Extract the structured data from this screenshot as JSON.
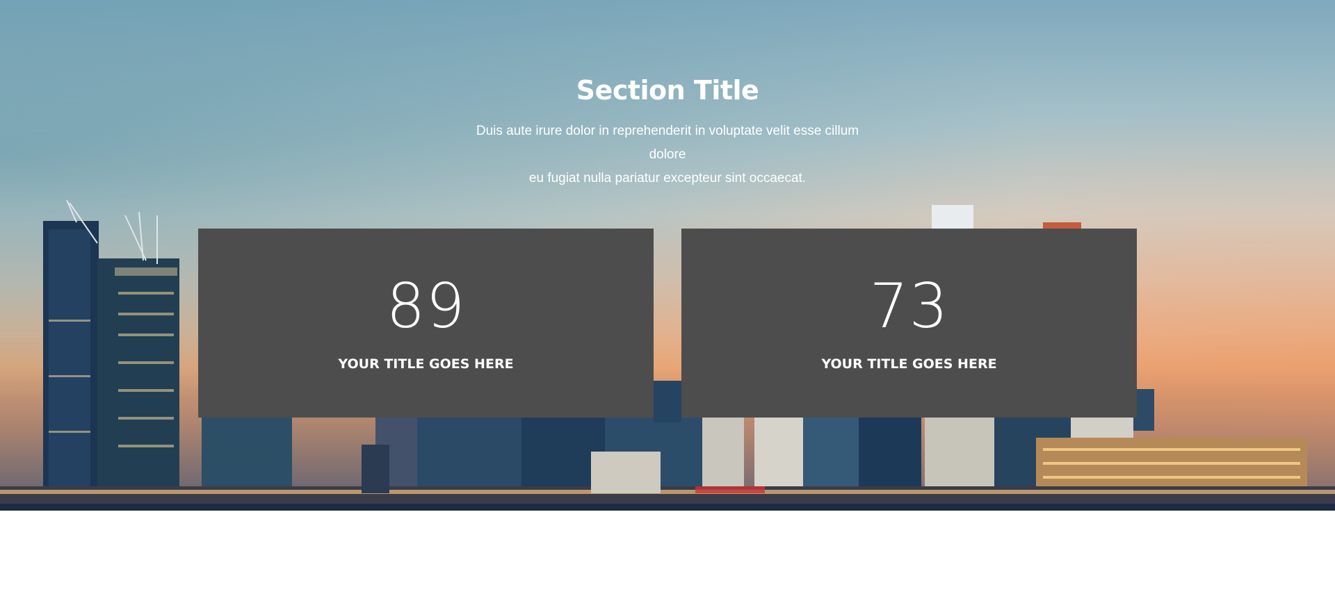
{
  "section": {
    "title": "Section Title",
    "subtitle_line1": "Duis aute irure dolor in reprehenderit in voluptate velit esse cillum dolore",
    "subtitle_line2": "eu fugiat nulla pariatur excepteur sint occaecat."
  },
  "counters": [
    {
      "number": "89",
      "label": "YOUR TITLE GOES HERE"
    },
    {
      "number": "73",
      "label": "YOUR TITLE GOES HERE"
    }
  ],
  "colors": {
    "card_background": "#4d4d4d",
    "text": "#ffffff",
    "page_background": "#ffffff"
  }
}
